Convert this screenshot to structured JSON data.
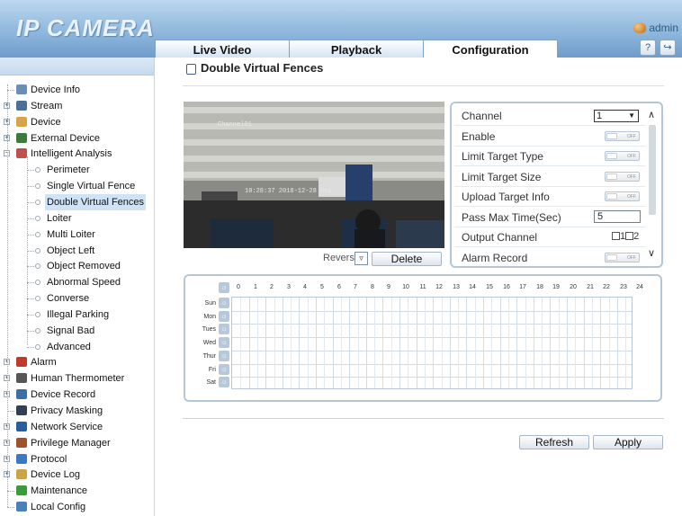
{
  "header": {
    "logo": "IP CAMERA",
    "user": "admin",
    "tabs": [
      {
        "label": "Live Video",
        "active": false
      },
      {
        "label": "Playback",
        "active": false
      },
      {
        "label": "Configuration",
        "active": true
      }
    ]
  },
  "sidebar": {
    "items": [
      {
        "label": "Device Info",
        "level": 0,
        "icon": "device-info-icon",
        "color": "#6b8fb4",
        "expandable": false
      },
      {
        "label": "Stream",
        "level": 0,
        "icon": "stream-icon",
        "color": "#4b6f96",
        "expandable": true
      },
      {
        "label": "Device",
        "level": 0,
        "icon": "device-icon",
        "color": "#d8a34a",
        "expandable": true
      },
      {
        "label": "External Device",
        "level": 0,
        "icon": "external-device-icon",
        "color": "#3d7a3d",
        "expandable": true
      },
      {
        "label": "Intelligent Analysis",
        "level": 0,
        "icon": "intelligent-analysis-icon",
        "color": "#c0504d",
        "expandable": true,
        "expanded": true
      },
      {
        "label": "Perimeter",
        "level": 1
      },
      {
        "label": "Single Virtual Fence",
        "level": 1
      },
      {
        "label": "Double Virtual Fences",
        "level": 1,
        "selected": true
      },
      {
        "label": "Loiter",
        "level": 1
      },
      {
        "label": "Multi Loiter",
        "level": 1
      },
      {
        "label": "Object Left",
        "level": 1
      },
      {
        "label": "Object Removed",
        "level": 1
      },
      {
        "label": "Abnormal Speed",
        "level": 1
      },
      {
        "label": "Converse",
        "level": 1
      },
      {
        "label": "Illegal Parking",
        "level": 1
      },
      {
        "label": "Signal Bad",
        "level": 1
      },
      {
        "label": "Advanced",
        "level": 1
      },
      {
        "label": "Alarm",
        "level": 0,
        "icon": "alarm-icon",
        "color": "#c0392b",
        "expandable": true
      },
      {
        "label": "Human Thermometer",
        "level": 0,
        "icon": "thermometer-icon",
        "color": "#555555",
        "expandable": true
      },
      {
        "label": "Device Record",
        "level": 0,
        "icon": "device-record-icon",
        "color": "#3a6ea5",
        "expandable": true
      },
      {
        "label": "Privacy Masking",
        "level": 0,
        "icon": "privacy-masking-icon",
        "color": "#2f3f55",
        "expandable": false
      },
      {
        "label": "Network Service",
        "level": 0,
        "icon": "network-service-icon",
        "color": "#2a5d9f",
        "expandable": true
      },
      {
        "label": "Privilege Manager",
        "level": 0,
        "icon": "privilege-manager-icon",
        "color": "#a0522d",
        "expandable": true
      },
      {
        "label": "Protocol",
        "level": 0,
        "icon": "protocol-icon",
        "color": "#3a79c4",
        "expandable": true
      },
      {
        "label": "Device Log",
        "level": 0,
        "icon": "device-log-icon",
        "color": "#c9a24a",
        "expandable": true
      },
      {
        "label": "Maintenance",
        "level": 0,
        "icon": "maintenance-icon",
        "color": "#3c9a3c",
        "expandable": false
      },
      {
        "label": "Local Config",
        "level": 0,
        "icon": "local-config-icon",
        "color": "#4a7fb8",
        "expandable": false
      }
    ]
  },
  "main": {
    "title": "Double Virtual Fences",
    "video": {
      "channel_overlay": "Channel01",
      "timestamp_overlay": "10:28:37 2018-12-28 Fri"
    },
    "reverse_label": "Reverse",
    "delete_label": "Delete",
    "params": [
      {
        "label": "Channel",
        "control": "select",
        "value": "1"
      },
      {
        "label": "Enable",
        "control": "toggle",
        "value": "OFF"
      },
      {
        "label": "Limit Target Type",
        "control": "toggle",
        "value": "OFF"
      },
      {
        "label": "Limit Target Size",
        "control": "toggle",
        "value": "OFF"
      },
      {
        "label": "Upload Target Info",
        "control": "toggle",
        "value": "OFF"
      },
      {
        "label": "Pass Max Time(Sec)",
        "control": "input",
        "value": "5"
      },
      {
        "label": "Output Channel",
        "control": "checkboxes",
        "options": [
          "1",
          "2"
        ]
      },
      {
        "label": "Alarm Record",
        "control": "toggle",
        "value": "OFF"
      }
    ],
    "schedule": {
      "hours": [
        "0",
        "1",
        "2",
        "3",
        "4",
        "5",
        "6",
        "7",
        "8",
        "9",
        "10",
        "11",
        "12",
        "13",
        "14",
        "15",
        "16",
        "17",
        "18",
        "19",
        "20",
        "21",
        "22",
        "23",
        "24"
      ],
      "days": [
        "Sun",
        "Mon",
        "Tues",
        "Wed",
        "Thur",
        "Fri",
        "Sat"
      ]
    },
    "refresh_label": "Refresh",
    "apply_label": "Apply"
  }
}
